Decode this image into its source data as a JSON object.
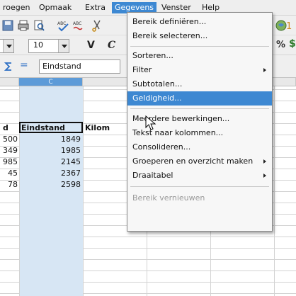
{
  "menubar": {
    "items": [
      {
        "label": "roegen"
      },
      {
        "label": "Opmaak"
      },
      {
        "label": "Extra"
      },
      {
        "label": "Gegevens"
      },
      {
        "label": "Venster"
      },
      {
        "label": "Help"
      }
    ]
  },
  "toolbar": {
    "font_size": "10",
    "bold_label": "V",
    "italic_label": "C",
    "percent_label": "%",
    "dollar_label": "$",
    "abc1": "ABC",
    "abc2": "ABC",
    "number_label": "1"
  },
  "formula": {
    "equals_label": "=",
    "value": "Eindstand"
  },
  "sheet": {
    "col_c_header": "C",
    "col_b_values": [
      "d",
      "500",
      "349",
      "985",
      "45",
      "78"
    ],
    "col_c_values": [
      "Eindstand",
      "1849",
      "1985",
      "2145",
      "2367",
      "2598"
    ],
    "col_d_header_text": "Kilom"
  },
  "menu": {
    "items": [
      {
        "label": "Bereik definiëren..."
      },
      {
        "label": "Bereik selecteren..."
      },
      {
        "label": "Sorteren..."
      },
      {
        "label": "Filter"
      },
      {
        "label": "Subtotalen..."
      },
      {
        "label": "Geldigheid..."
      },
      {
        "label": "Meerdere bewerkingen..."
      },
      {
        "label": "Tekst naar kolommen..."
      },
      {
        "label": "Consolideren..."
      },
      {
        "label": "Groeperen en overzicht maken"
      },
      {
        "label": "Draaitabel"
      },
      {
        "label": "Bereik vernieuwen"
      }
    ]
  },
  "colors": {
    "highlight": "#3d88d2",
    "selected_column": "#d7e6f4",
    "selected_header": "#5d9bd8"
  }
}
